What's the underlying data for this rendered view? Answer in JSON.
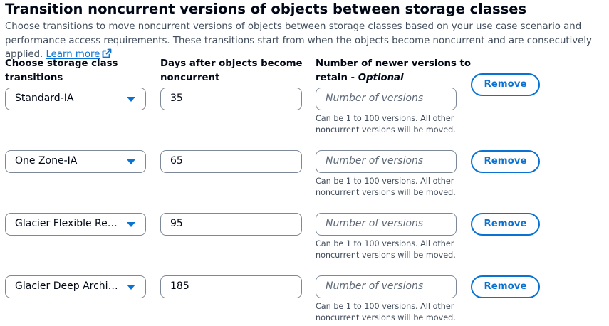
{
  "section": {
    "title": "Transition noncurrent versions of objects between storage classes",
    "description": "Choose transitions to move noncurrent versions of objects between storage classes based on your use case scenario and performance access requirements. These transitions start from when the objects become noncurrent and are consecutively applied.",
    "learn_more": "Learn more"
  },
  "columns": {
    "storage_class": [
      "Choose storage class",
      "transitions"
    ],
    "days": [
      "Days after objects become",
      "noncurrent"
    ],
    "versions_line1": "Number of newer versions to",
    "versions_line2": "retain - ",
    "versions_optional": "Optional"
  },
  "rows": [
    {
      "storage_class": "Standard-IA",
      "days": "35",
      "versions_placeholder": "Number of versions",
      "hint": [
        "Can be 1 to 100 versions. All other",
        "noncurrent versions will be moved."
      ],
      "remove_label": "Remove"
    },
    {
      "storage_class": "One Zone-IA",
      "days": "65",
      "versions_placeholder": "Number of versions",
      "hint": [
        "Can be 1 to 100 versions. All other",
        "noncurrent versions will be moved."
      ],
      "remove_label": "Remove"
    },
    {
      "storage_class": "Glacier Flexible Retri…",
      "days": "95",
      "versions_placeholder": "Number of versions",
      "hint": [
        "Can be 1 to 100 versions. All other",
        "noncurrent versions will be moved."
      ],
      "remove_label": "Remove"
    },
    {
      "storage_class": "Glacier Deep Archive",
      "days": "185",
      "versions_placeholder": "Number of versions",
      "hint": [
        "Can be 1 to 100 versions. All other",
        "noncurrent versions will be moved."
      ],
      "remove_label": "Remove"
    }
  ],
  "icons": {
    "dropdown": "caret-down-icon",
    "external_link": "external-link-icon"
  },
  "colors": {
    "accent": "#0972d3",
    "text": "#000716",
    "secondary_text": "#414d5c",
    "border": "#7d8998"
  }
}
